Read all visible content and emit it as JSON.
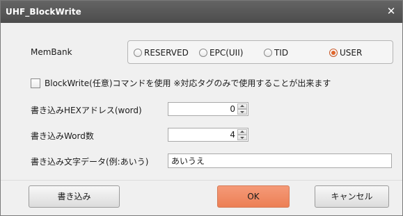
{
  "window": {
    "title": "UHF_BlockWrite",
    "close_glyph": "✕"
  },
  "membank": {
    "label": "MemBank",
    "options": [
      {
        "label": "RESERVED",
        "checked": false
      },
      {
        "label": "EPC(UII)",
        "checked": false
      },
      {
        "label": "TID",
        "checked": false
      },
      {
        "label": "USER",
        "checked": true
      }
    ]
  },
  "blockwrite_checkbox": {
    "label": "BlockWrite(任意)コマンドを使用 ※対応タグのみで使用することが出来ます",
    "checked": false
  },
  "hex_address": {
    "label": "書き込みHEXアドレス(word)",
    "value": "0"
  },
  "word_count": {
    "label": "書き込みWord数",
    "value": "4"
  },
  "text_data": {
    "label": "書き込み文字データ(例:あいう)",
    "value": "あいうえ"
  },
  "buttons": {
    "write": "書き込み",
    "ok": "OK",
    "cancel": "キャンセル"
  },
  "colors": {
    "titlebar": "#555555",
    "accent": "#ec7f55",
    "radio_selected": "#e0662c"
  }
}
